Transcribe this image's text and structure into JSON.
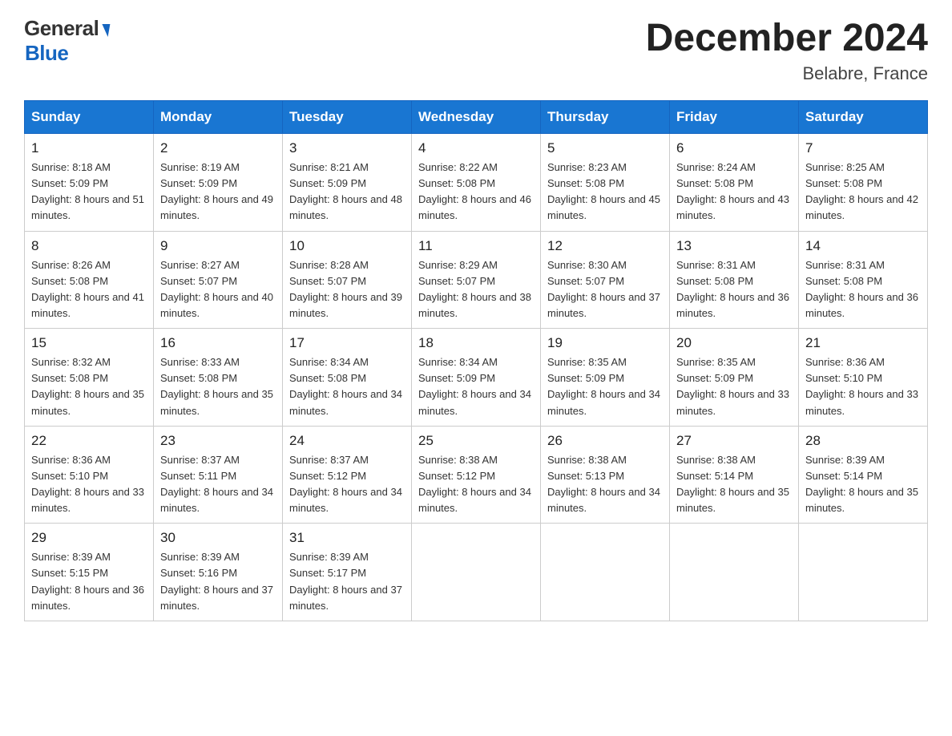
{
  "header": {
    "title": "December 2024",
    "location": "Belabre, France",
    "logo_general": "General",
    "logo_blue": "Blue"
  },
  "calendar": {
    "days_of_week": [
      "Sunday",
      "Monday",
      "Tuesday",
      "Wednesday",
      "Thursday",
      "Friday",
      "Saturday"
    ],
    "weeks": [
      [
        {
          "date": "1",
          "sunrise": "8:18 AM",
          "sunset": "5:09 PM",
          "daylight": "8 hours and 51 minutes."
        },
        {
          "date": "2",
          "sunrise": "8:19 AM",
          "sunset": "5:09 PM",
          "daylight": "8 hours and 49 minutes."
        },
        {
          "date": "3",
          "sunrise": "8:21 AM",
          "sunset": "5:09 PM",
          "daylight": "8 hours and 48 minutes."
        },
        {
          "date": "4",
          "sunrise": "8:22 AM",
          "sunset": "5:08 PM",
          "daylight": "8 hours and 46 minutes."
        },
        {
          "date": "5",
          "sunrise": "8:23 AM",
          "sunset": "5:08 PM",
          "daylight": "8 hours and 45 minutes."
        },
        {
          "date": "6",
          "sunrise": "8:24 AM",
          "sunset": "5:08 PM",
          "daylight": "8 hours and 43 minutes."
        },
        {
          "date": "7",
          "sunrise": "8:25 AM",
          "sunset": "5:08 PM",
          "daylight": "8 hours and 42 minutes."
        }
      ],
      [
        {
          "date": "8",
          "sunrise": "8:26 AM",
          "sunset": "5:08 PM",
          "daylight": "8 hours and 41 minutes."
        },
        {
          "date": "9",
          "sunrise": "8:27 AM",
          "sunset": "5:07 PM",
          "daylight": "8 hours and 40 minutes."
        },
        {
          "date": "10",
          "sunrise": "8:28 AM",
          "sunset": "5:07 PM",
          "daylight": "8 hours and 39 minutes."
        },
        {
          "date": "11",
          "sunrise": "8:29 AM",
          "sunset": "5:07 PM",
          "daylight": "8 hours and 38 minutes."
        },
        {
          "date": "12",
          "sunrise": "8:30 AM",
          "sunset": "5:07 PM",
          "daylight": "8 hours and 37 minutes."
        },
        {
          "date": "13",
          "sunrise": "8:31 AM",
          "sunset": "5:08 PM",
          "daylight": "8 hours and 36 minutes."
        },
        {
          "date": "14",
          "sunrise": "8:31 AM",
          "sunset": "5:08 PM",
          "daylight": "8 hours and 36 minutes."
        }
      ],
      [
        {
          "date": "15",
          "sunrise": "8:32 AM",
          "sunset": "5:08 PM",
          "daylight": "8 hours and 35 minutes."
        },
        {
          "date": "16",
          "sunrise": "8:33 AM",
          "sunset": "5:08 PM",
          "daylight": "8 hours and 35 minutes."
        },
        {
          "date": "17",
          "sunrise": "8:34 AM",
          "sunset": "5:08 PM",
          "daylight": "8 hours and 34 minutes."
        },
        {
          "date": "18",
          "sunrise": "8:34 AM",
          "sunset": "5:09 PM",
          "daylight": "8 hours and 34 minutes."
        },
        {
          "date": "19",
          "sunrise": "8:35 AM",
          "sunset": "5:09 PM",
          "daylight": "8 hours and 34 minutes."
        },
        {
          "date": "20",
          "sunrise": "8:35 AM",
          "sunset": "5:09 PM",
          "daylight": "8 hours and 33 minutes."
        },
        {
          "date": "21",
          "sunrise": "8:36 AM",
          "sunset": "5:10 PM",
          "daylight": "8 hours and 33 minutes."
        }
      ],
      [
        {
          "date": "22",
          "sunrise": "8:36 AM",
          "sunset": "5:10 PM",
          "daylight": "8 hours and 33 minutes."
        },
        {
          "date": "23",
          "sunrise": "8:37 AM",
          "sunset": "5:11 PM",
          "daylight": "8 hours and 34 minutes."
        },
        {
          "date": "24",
          "sunrise": "8:37 AM",
          "sunset": "5:12 PM",
          "daylight": "8 hours and 34 minutes."
        },
        {
          "date": "25",
          "sunrise": "8:38 AM",
          "sunset": "5:12 PM",
          "daylight": "8 hours and 34 minutes."
        },
        {
          "date": "26",
          "sunrise": "8:38 AM",
          "sunset": "5:13 PM",
          "daylight": "8 hours and 34 minutes."
        },
        {
          "date": "27",
          "sunrise": "8:38 AM",
          "sunset": "5:14 PM",
          "daylight": "8 hours and 35 minutes."
        },
        {
          "date": "28",
          "sunrise": "8:39 AM",
          "sunset": "5:14 PM",
          "daylight": "8 hours and 35 minutes."
        }
      ],
      [
        {
          "date": "29",
          "sunrise": "8:39 AM",
          "sunset": "5:15 PM",
          "daylight": "8 hours and 36 minutes."
        },
        {
          "date": "30",
          "sunrise": "8:39 AM",
          "sunset": "5:16 PM",
          "daylight": "8 hours and 37 minutes."
        },
        {
          "date": "31",
          "sunrise": "8:39 AM",
          "sunset": "5:17 PM",
          "daylight": "8 hours and 37 minutes."
        },
        null,
        null,
        null,
        null
      ]
    ]
  }
}
